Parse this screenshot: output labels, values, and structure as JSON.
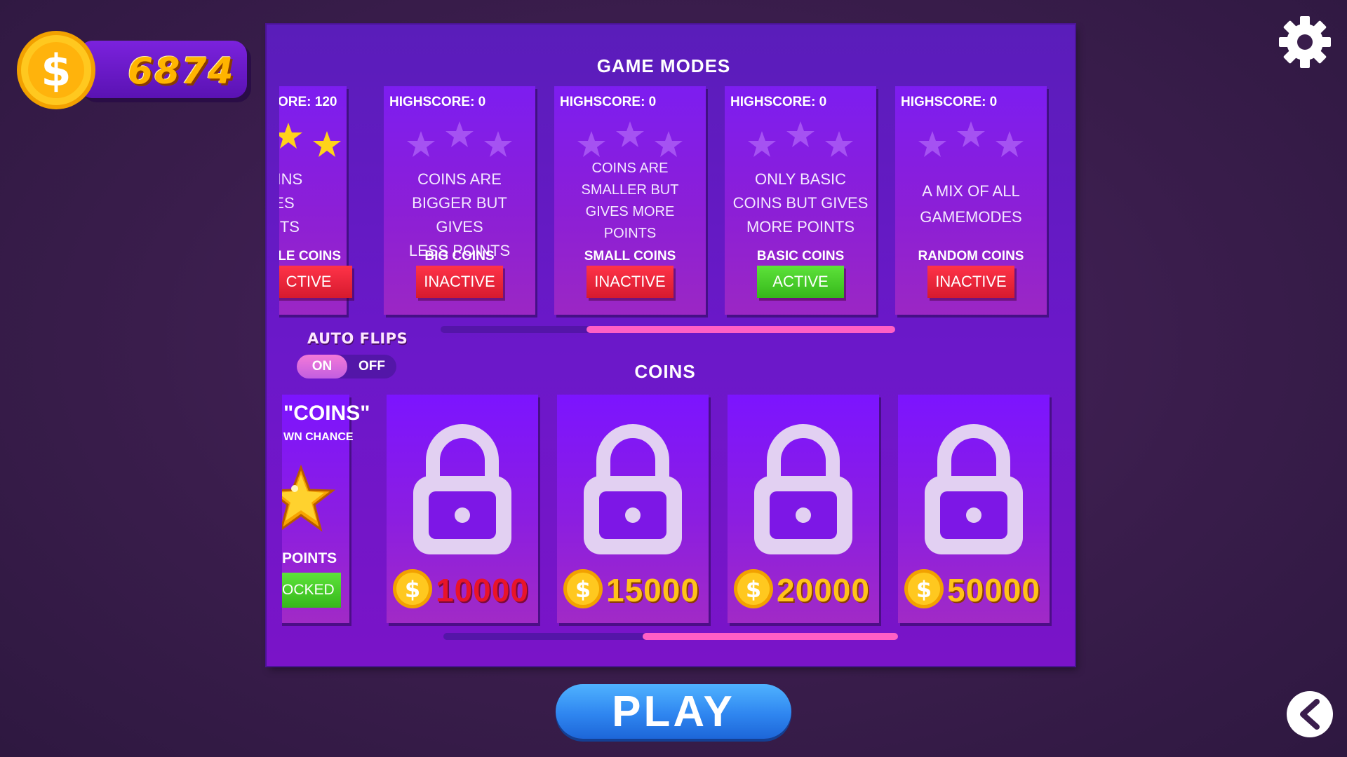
{
  "balance": {
    "amount": "6874",
    "icon": "dollar-coin-icon"
  },
  "settings": {
    "icon": "gear-icon"
  },
  "game_modes": {
    "title": "GAME MODES",
    "cards": [
      {
        "highscore": "ORE: 120",
        "stars_earned": 2,
        "desc_lines": [
          "X COINS",
          "GIVES",
          "POINTS"
        ],
        "name": "LE COINS",
        "status": "CTIVE",
        "status_color": "red"
      },
      {
        "highscore": "HIGHSCORE: 0",
        "stars_earned": 0,
        "desc_lines": [
          "COINS ARE",
          "BIGGER BUT GIVES",
          "LESS POINTS"
        ],
        "name": "BIG COINS",
        "status": "INACTIVE",
        "status_color": "red"
      },
      {
        "highscore": "HIGHSCORE: 0",
        "stars_earned": 0,
        "desc_lines": [
          "COINS ARE",
          "SMALLER BUT",
          "GIVES MORE",
          "POINTS"
        ],
        "name": "SMALL COINS",
        "status": "INACTIVE",
        "status_color": "red"
      },
      {
        "highscore": "HIGHSCORE: 0",
        "stars_earned": 0,
        "desc_lines": [
          "ONLY BASIC",
          "COINS BUT GIVES",
          "MORE POINTS"
        ],
        "name": "BASIC COINS",
        "status": "ACTIVE",
        "status_color": "green"
      },
      {
        "highscore": "HIGHSCORE: 0",
        "stars_earned": 0,
        "desc_lines": [
          "A MIX OF ALL",
          "GAMEMODES"
        ],
        "name": "RANDOM COINS",
        "status": "INACTIVE",
        "status_color": "red"
      }
    ],
    "scroll_position": 0.55
  },
  "auto_flips": {
    "label": "AUTO FLIPS",
    "on_label": "ON",
    "off_label": "OFF",
    "selected": "ON"
  },
  "coins": {
    "title": "COINS",
    "first_card": {
      "title": "\"COINS\"",
      "subtitle": "WN CHANCE",
      "points": "POINTS",
      "button": "OCKED"
    },
    "locked_cards": [
      {
        "price": "10000",
        "price_color": "red"
      },
      {
        "price": "15000",
        "price_color": "gold"
      },
      {
        "price": "20000",
        "price_color": "gold"
      },
      {
        "price": "50000",
        "price_color": "gold"
      }
    ],
    "scroll_position": 0.55
  },
  "play_button": {
    "label": "PLAY"
  },
  "back_button": {
    "icon": "chevron-left-icon"
  },
  "colors": {
    "accent_pink": "#ff5fc5",
    "active_green": "#36b81b",
    "inactive_red": "#d61a2e",
    "panel_purple": "#6b18c9"
  }
}
